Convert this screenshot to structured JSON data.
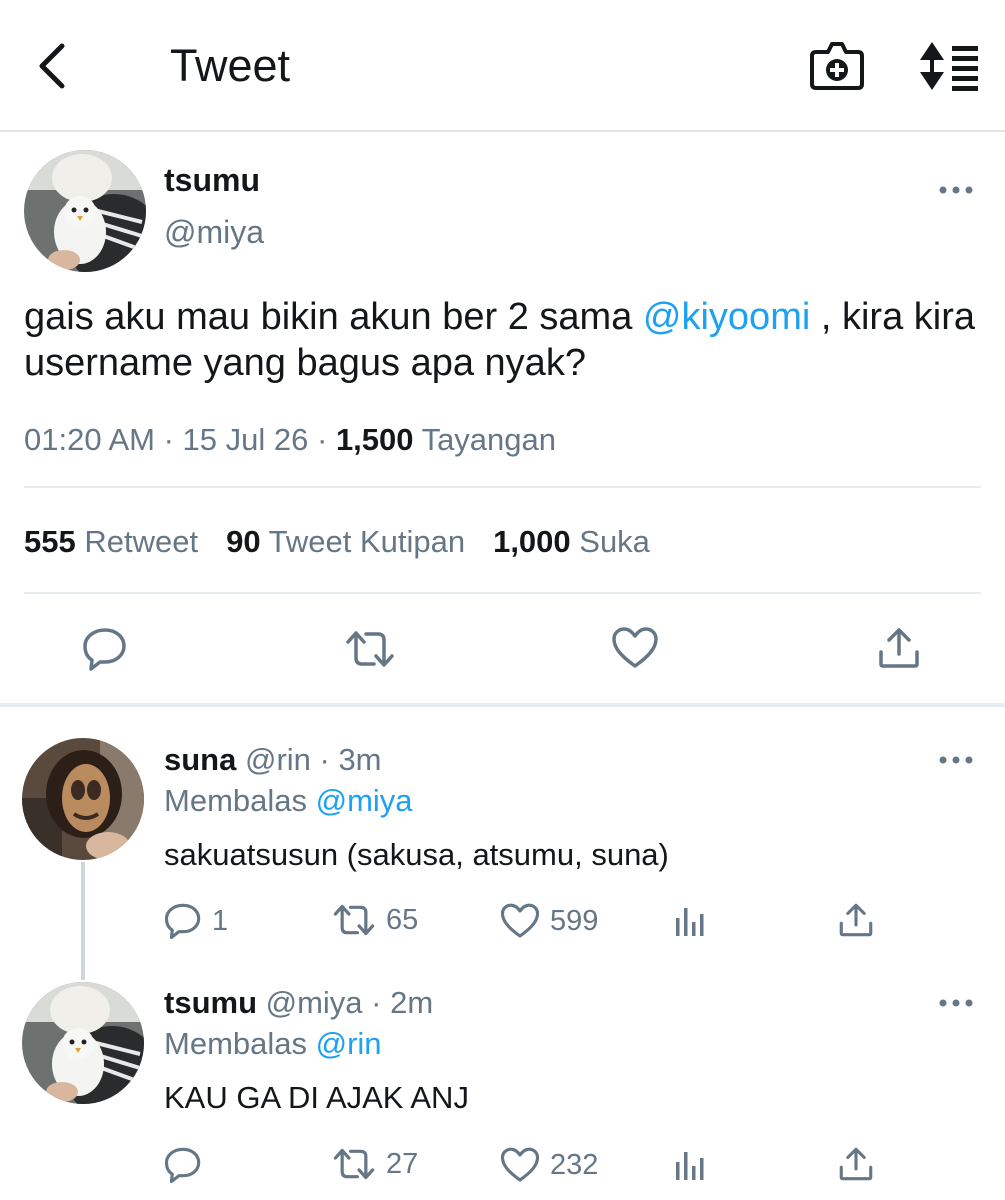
{
  "header": {
    "title": "Tweet",
    "back_icon": "chevron-left-icon",
    "camera_icon": "camera-plus-icon",
    "sort_icon": "sort-lines-icon"
  },
  "main_tweet": {
    "display_name": "tsumu",
    "handle": "@miya",
    "text_part1": "gais aku mau bikin akun ber 2 sama ",
    "mention": "@kiyoomi",
    "text_part2": " , kira kira username yang bagus apa nyak?",
    "time": "01:20 AM",
    "sep": " · ",
    "date": "15 Jul 26",
    "views_count": "1,500",
    "views_label": " Tayangan",
    "retweets_count": "555",
    "retweets_label": " Retweet",
    "quotes_count": "90",
    "quotes_label": " Tweet Kutipan",
    "likes_count": "1,000",
    "likes_label": " Suka"
  },
  "replies": [
    {
      "display_name": "suna",
      "handle_time": " @rin · 3m",
      "replying_label": "Membalas ",
      "replying_to": "@miya",
      "text": "sakuatsusun (sakusa, atsumu, suna)",
      "reply_count": "1",
      "retweet_count": "65",
      "like_count": "599"
    },
    {
      "display_name": "tsumu",
      "handle_time": " @miya · 2m",
      "replying_label": "Membalas ",
      "replying_to": "@rin",
      "text": "KAU GA DI AJAK ANJ",
      "reply_count": "",
      "retweet_count": "27",
      "like_count": "232"
    }
  ],
  "colors": {
    "accent": "#1da1f2",
    "muted": "#657786",
    "divider": "#e6ecf0"
  }
}
